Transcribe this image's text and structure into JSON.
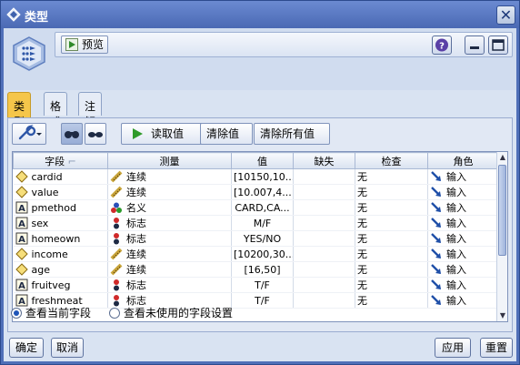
{
  "window": {
    "title": "类型",
    "close_glyph": "✕"
  },
  "header": {
    "preview_label": "预览",
    "help_glyph": "?"
  },
  "tabs": [
    {
      "label": "类型",
      "active": true
    },
    {
      "label": "格式",
      "active": false
    },
    {
      "label": "注解",
      "active": false
    }
  ],
  "toolbar": {
    "read_values": "读取值",
    "clear_values": "清除值",
    "clear_all_values": "清除所有值"
  },
  "table": {
    "columns": [
      "字段",
      "测量",
      "值",
      "缺失",
      "检查",
      "角色"
    ],
    "rows": [
      {
        "field": "cardid",
        "field_icon": "continuous-diamond-icon",
        "measure": "连续",
        "measure_icon": "ruler-icon",
        "values": "[10150,10...",
        "missing": "",
        "check": "无",
        "role": "输入"
      },
      {
        "field": "value",
        "field_icon": "continuous-diamond-icon",
        "measure": "连续",
        "measure_icon": "ruler-icon",
        "values": "[10.007,4...",
        "missing": "",
        "check": "无",
        "role": "输入"
      },
      {
        "field": "pmethod",
        "field_icon": "string-a-icon",
        "measure": "名义",
        "measure_icon": "nominal-balls-icon",
        "values": "CARD,CA...",
        "missing": "",
        "check": "无",
        "role": "输入"
      },
      {
        "field": "sex",
        "field_icon": "string-a-icon",
        "measure": "标志",
        "measure_icon": "flag-balls-icon",
        "values": "M/F",
        "missing": "",
        "check": "无",
        "role": "输入"
      },
      {
        "field": "homeown",
        "field_icon": "string-a-icon",
        "measure": "标志",
        "measure_icon": "flag-balls-icon",
        "values": "YES/NO",
        "missing": "",
        "check": "无",
        "role": "输入"
      },
      {
        "field": "income",
        "field_icon": "continuous-diamond-icon",
        "measure": "连续",
        "measure_icon": "ruler-icon",
        "values": "[10200,30...",
        "missing": "",
        "check": "无",
        "role": "输入"
      },
      {
        "field": "age",
        "field_icon": "continuous-diamond-icon",
        "measure": "连续",
        "measure_icon": "ruler-icon",
        "values": "[16,50]",
        "missing": "",
        "check": "无",
        "role": "输入"
      },
      {
        "field": "fruitveg",
        "field_icon": "string-a-icon",
        "measure": "标志",
        "measure_icon": "flag-balls-icon",
        "values": "T/F",
        "missing": "",
        "check": "无",
        "role": "输入"
      },
      {
        "field": "freshmeat",
        "field_icon": "string-a-icon",
        "measure": "标志",
        "measure_icon": "flag-balls-icon",
        "values": "T/F",
        "missing": "",
        "check": "无",
        "role": "输入"
      }
    ]
  },
  "view_options": {
    "current_fields": "查看当前字段",
    "unused_fields": "查看未使用的字段设置",
    "selected": "current_fields"
  },
  "footer": {
    "ok": "确定",
    "cancel": "取消",
    "apply": "应用",
    "reset": "重置"
  },
  "colors": {
    "titlebar": "#4a69b4",
    "active_tab": "#f5c64a",
    "role_arrow": "#1f4fa8"
  }
}
